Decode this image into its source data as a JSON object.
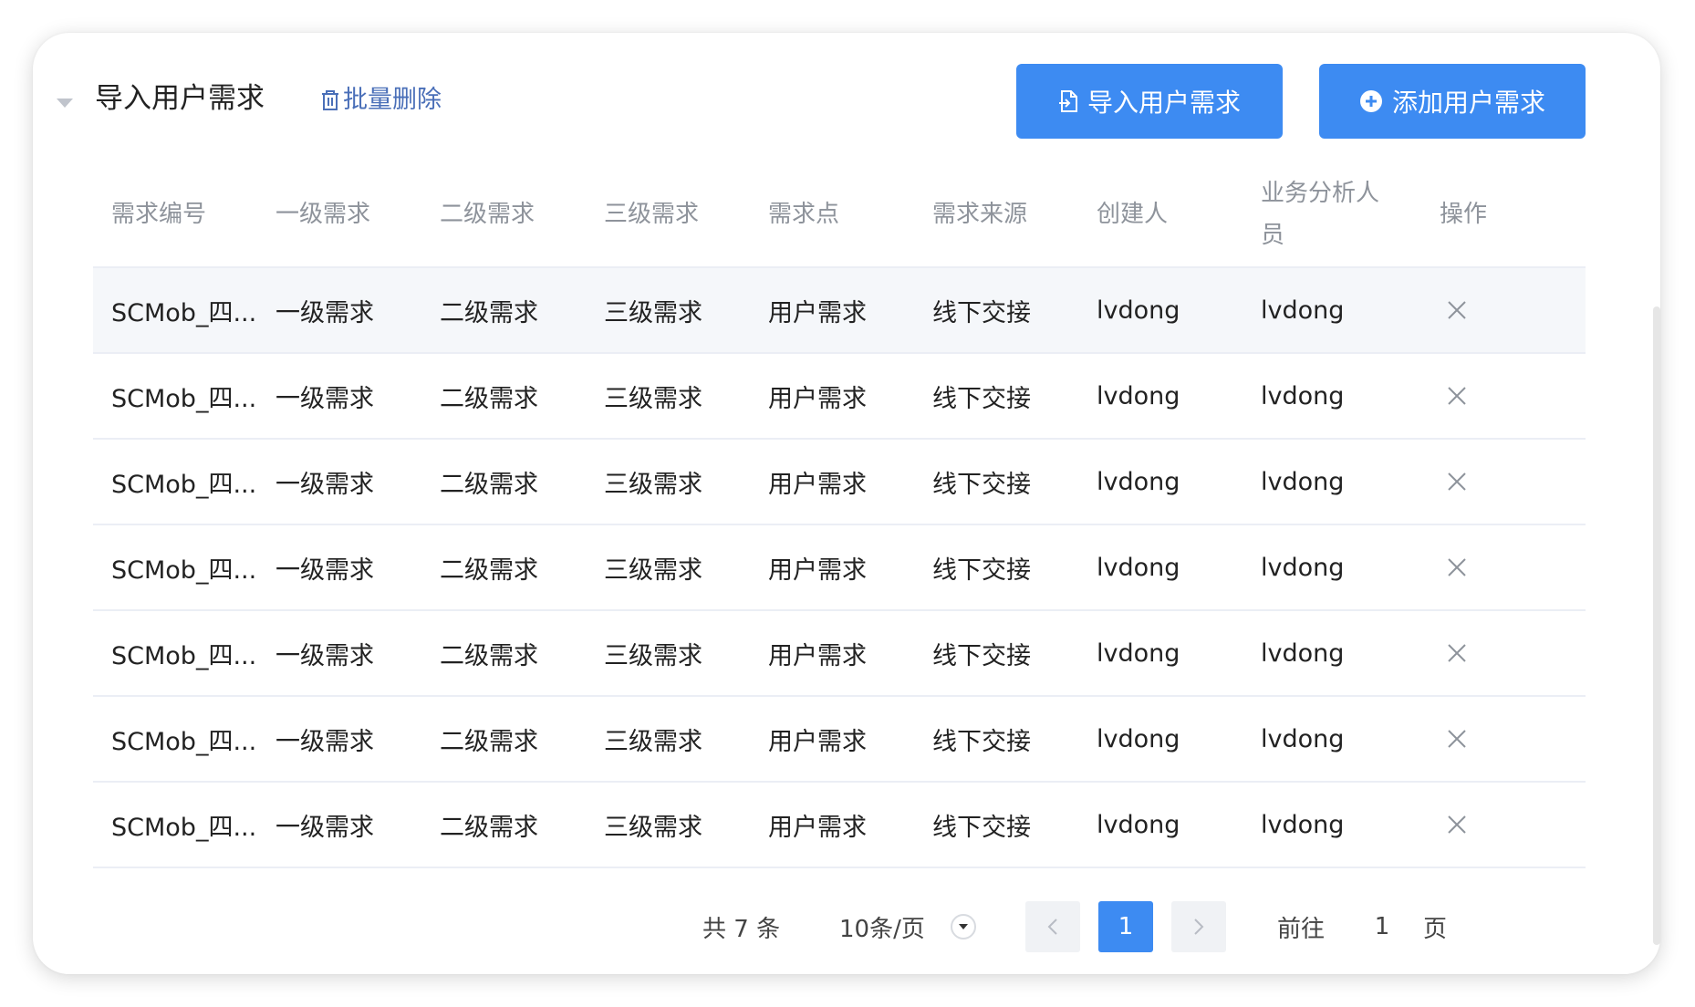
{
  "section": {
    "title": "导入用户需求",
    "batch_delete_label": "批量删除"
  },
  "buttons": {
    "import_label": "导入用户需求",
    "add_label": "添加用户需求"
  },
  "table": {
    "columns": [
      "需求编号",
      "一级需求",
      "二级需求",
      "三级需求",
      "需求点",
      "需求来源",
      "创建人",
      "业务分析人员",
      "操作"
    ],
    "rows": [
      [
        "SCMob_四...",
        "一级需求",
        "二级需求",
        "三级需求",
        "用户需求",
        "线下交接",
        "lvdong",
        "lvdong"
      ],
      [
        "SCMob_四...",
        "一级需求",
        "二级需求",
        "三级需求",
        "用户需求",
        "线下交接",
        "lvdong",
        "lvdong"
      ],
      [
        "SCMob_四...",
        "一级需求",
        "二级需求",
        "三级需求",
        "用户需求",
        "线下交接",
        "lvdong",
        "lvdong"
      ],
      [
        "SCMob_四...",
        "一级需求",
        "二级需求",
        "三级需求",
        "用户需求",
        "线下交接",
        "lvdong",
        "lvdong"
      ],
      [
        "SCMob_四...",
        "一级需求",
        "二级需求",
        "三级需求",
        "用户需求",
        "线下交接",
        "lvdong",
        "lvdong"
      ],
      [
        "SCMob_四...",
        "一级需求",
        "二级需求",
        "三级需求",
        "用户需求",
        "线下交接",
        "lvdong",
        "lvdong"
      ],
      [
        "SCMob_四...",
        "一级需求",
        "二级需求",
        "三级需求",
        "用户需求",
        "线下交接",
        "lvdong",
        "lvdong"
      ]
    ],
    "row_action_icon": "close-icon"
  },
  "pagination": {
    "total_text": "共 7 条",
    "page_size_text": "10条/页",
    "current_page": "1",
    "goto_label": "前往",
    "goto_value": "1",
    "page_suffix": "页"
  },
  "colors": {
    "primary": "#3d8bf2",
    "link": "#4a6fb8",
    "header_text": "#8e939b",
    "row_highlight": "#f5f7fa"
  }
}
